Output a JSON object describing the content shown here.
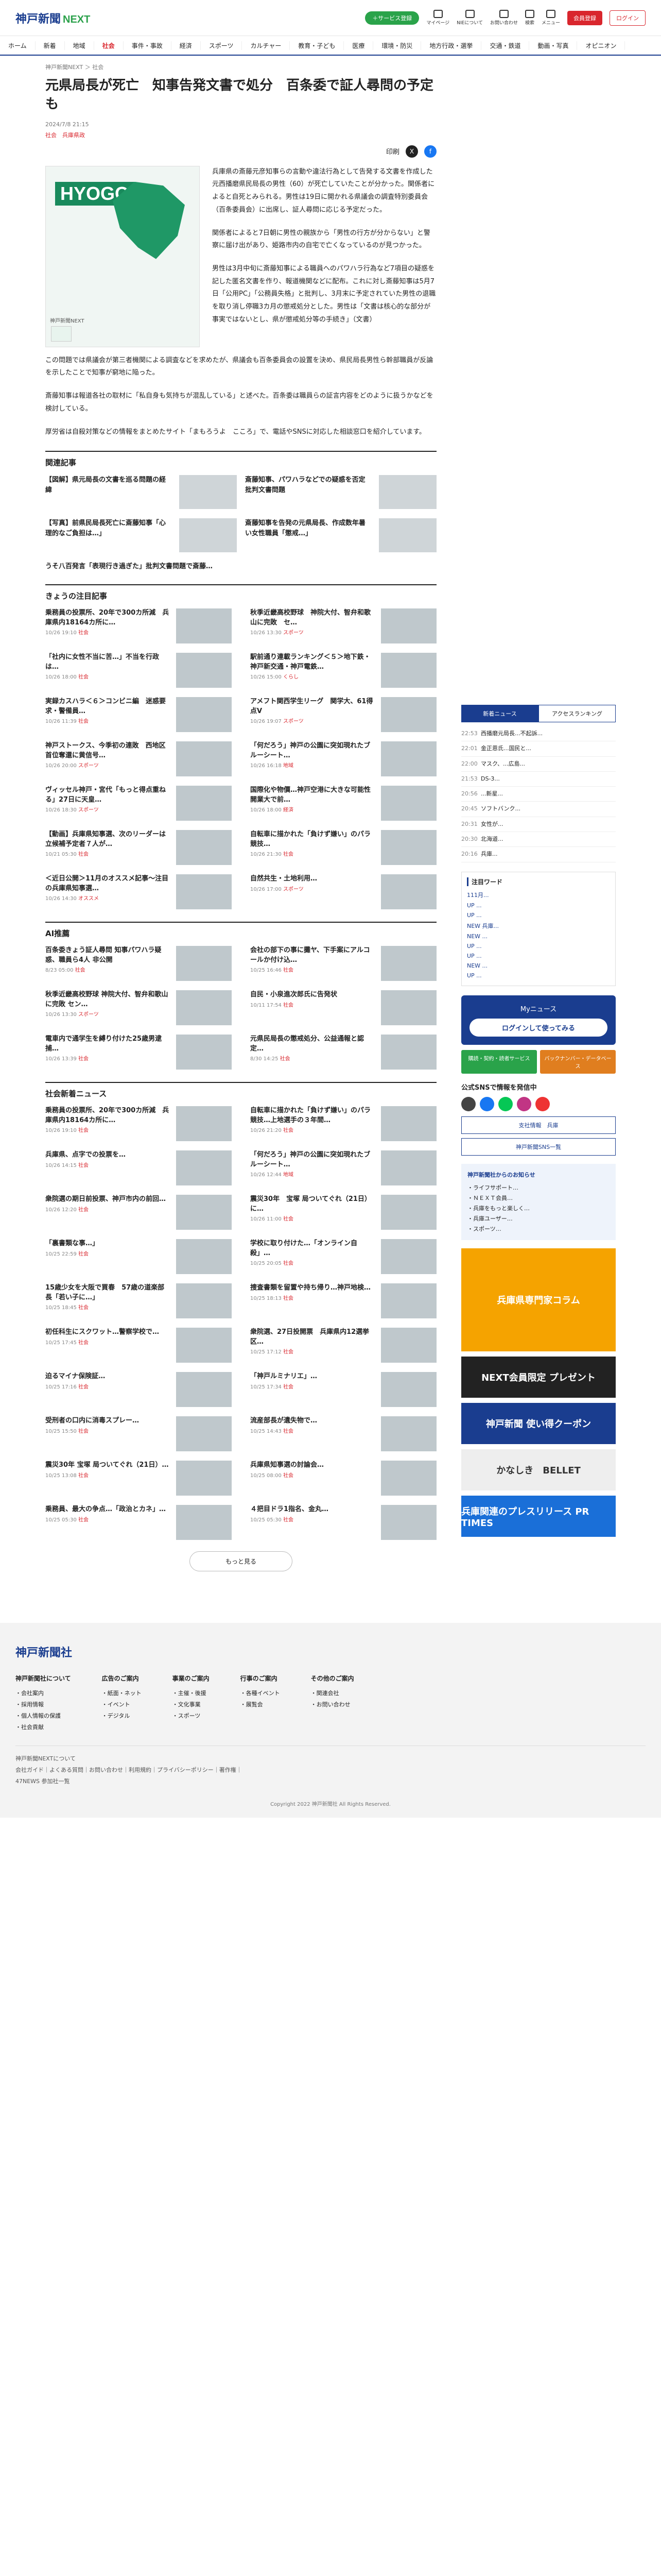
{
  "header": {
    "logo": "神戸新聞",
    "logo_next": "NEXT",
    "signup": "＋サービス登録",
    "icons": [
      "マイページ",
      "NIEについて",
      "お問い合わせ",
      "検索",
      "メニュー"
    ],
    "member": "会員登録",
    "login": "ログイン"
  },
  "nav": [
    "ホーム",
    "新着",
    "地域",
    "社会",
    "事件・事故",
    "経済",
    "スポーツ",
    "カルチャー",
    "教育・子ども",
    "医療",
    "環境・防災",
    "地方行政・選挙",
    "交通・鉄道",
    "動画・写真",
    "オピニオン"
  ],
  "crumb": "神戸新聞NEXT ＞ 社会",
  "article": {
    "title": "元県局長が死亡　知事告発文書で処分　百条委で証人尋問の予定も",
    "date": "2024/7/8 21:15",
    "tags": "社会　兵庫県政",
    "print": "印刷",
    "map_label": "HYOGO",
    "map_caption": "神戸新聞NEXT",
    "p1": "兵庫県の斎藤元彦知事らの言動や違法行為として告発する文書を作成した元西播磨県民局長の男性（60）が死亡していたことが分かった。関係者によると自死とみられる。男性は19日に開かれる県議会の調査特別委員会（百条委員会）に出席し、証人尋問に応じる予定だった。",
    "p2": "関係者によると7日朝に男性の親族から「男性の行方が分からない」と警察に届け出があり、姫路市内の自宅で亡くなっているのが見つかった。",
    "p3": "男性は3月中旬に斎藤知事による職員へのパワハラ行為など7項目の疑惑を記した匿名文書を作り、報道機関などに配布。これに対し斎藤知事は5月7日「公用PC」「公務員失格」と批判し、3月末に予定されていた男性の退職を取り消し停職3カ月の懲戒処分とした。男性は「文書は核心的な部分が事実ではないとし、県が懲戒処分等の手続き」（文書）",
    "p4": "この問題では県議会が第三者機関による調査などを求めたが、県議会も百条委員会の設置を決め、県民局長男性ら幹部職員が反論を示したことで知事が窮地に陥った。",
    "p5": "斎藤知事は報道各社の取材に「私自身も気持ちが混乱している」と述べた。百条委は職員らの証言内容をどのように扱うかなどを検討している。",
    "p6": "厚労省は自殺対策などの情報をまとめたサイト「まもろうよ　こころ」で、電話やSNSに対応した相談窓口を紹介しています。"
  },
  "related": {
    "title": "関連記事",
    "items": [
      "【図解】県元局長の文書を巡る問題の経緯",
      "斎藤知事、パワハラなどでの疑惑を否定　批判文書問題",
      "【写真】前県民局長死亡に斎藤知事「心理的なご負担は…」",
      "斎藤知事を告発の元県局長、作成数年暑い女性職員「懲戒…」",
      "うそ八百発言「表現行き過ぎた」批判文書問題で斎藤…"
    ]
  },
  "popular": {
    "title": "きょうの注目記事",
    "items": [
      [
        "乗務員の投票所、20年で300カ所減　兵庫県内18164カ所に…",
        "10/26 19:10",
        "社会"
      ],
      [
        "秋季近畿高校野球　神院大付、智弁和歌山に完敗　セ…",
        "10/26 13:30",
        "スポーツ"
      ],
      [
        "「社内に女性不当に苦…」不当を行政は…",
        "10/26 18:00",
        "社会"
      ],
      [
        "駅前通り連載ランキング＜５＞地下鉄・神戸新交通・神戸電鉄…",
        "10/26 15:00",
        "くらし"
      ],
      [
        "実録カスハラ＜６＞コンビニ編　迷惑要求・警備員…",
        "10/26 11:39",
        "社会"
      ],
      [
        "アメフト関西学生リーグ　関学大、61得点V",
        "10/26 19:07",
        "スポーツ"
      ],
      [
        "神戸ストークス、今季初の連敗　西地区首位奪還に黄信号…",
        "10/26 20:00",
        "スポーツ"
      ],
      [
        "「何だろう」神戸の公園に突如現れたブルーシート…",
        "10/26 16:18",
        "地域"
      ],
      [
        "ヴィッセル神戸・宮代「もっと得点重ねる」27日に天皇…",
        "10/26 18:30",
        "スポーツ"
      ],
      [
        "国際化や物價…神戸空港に大きな可能性　開業大で前…",
        "10/26 18:00",
        "経済"
      ],
      [
        "【動画】兵庫県知事選、次のリーダーは　立候補予定者７人が…",
        "10/21 05:30",
        "社会"
      ],
      [
        "自転車に描かれた「負けず嫌い」のパラ競技…",
        "10/26 21:30",
        "社会"
      ],
      [
        "＜近日公開＞11月のオススメ記事〜注目の兵庫県知事選…",
        "10/26 14:30",
        "オススメ"
      ],
      [
        "自然共生・土地利用…",
        "10/26 17:00",
        "スポーツ"
      ]
    ]
  },
  "ai": {
    "title": "AI推薦",
    "items": [
      [
        "百条委きょう証人尋問 知事パワハラ疑惑、職員ら4人 非公開",
        "8/23 05:00",
        "社会"
      ],
      [
        "会社の部下の事に攤ヤ、下手案にアルコールか付け込…",
        "10/25 16:46",
        "社会"
      ],
      [
        "秋季近畿高校野球 神院大付、智弁和歌山に完敗 セン…",
        "10/26 13:30",
        "スポーツ"
      ],
      [
        "自民・小泉進次郎氏に告発状",
        "10/11 17:54",
        "社会"
      ],
      [
        "電車内で通学生を縛り付けた25歳男逮捕…",
        "10/26 13:39",
        "社会"
      ],
      [
        "元県民局長の懲戒処分、公益通報と認定…",
        "8/30 14:25",
        "社会"
      ]
    ]
  },
  "social": {
    "title": "社会新着ニュース",
    "items": [
      [
        "乗務員の投票所、20年で300カ所減　兵庫県内18164カ所に…",
        "10/26 19:10",
        "社会"
      ],
      [
        "自転車に描かれた「負けず嫌い」のパラ競技…上地選手の３年間…",
        "10/26 21:20",
        "社会"
      ],
      [
        "兵庫県、点字での投票を…",
        "10/26 14:15",
        "社会"
      ],
      [
        "「何だろう」神戸の公園に突如現れたブルーシート…",
        "10/26 12:44",
        "地域"
      ],
      [
        "衆院選の期日前投票、神戸市内の前回…",
        "10/26 12:20",
        "社会"
      ],
      [
        "震災30年　宝塚 局ついてぐれ（21日）に…",
        "10/26 11:00",
        "社会"
      ],
      [
        "「裏書類な事…」",
        "10/25 22:59",
        "社会"
      ],
      [
        "学校に取り付けた…「オンライン自殺」…",
        "10/25 20:05",
        "社会"
      ],
      [
        "15歳少女を大阪で買春　57歳の道楽部長「若い子に…」",
        "10/25 18:45",
        "社会"
      ],
      [
        "捜査書類を留置や持ち帰り…神戸地検…",
        "10/25 18:13",
        "社会"
      ],
      [
        "初任科生にスクワット…警察学校で…",
        "10/25 17:45",
        "社会"
      ],
      [
        "衆院選、27日投開票　兵庫県内12選挙区…",
        "10/25 17:12",
        "社会"
      ],
      [
        "迫るマイナ保険証…",
        "10/25 17:16",
        "社会"
      ],
      [
        "「神戸ルミナリエ」…",
        "10/25 17:34",
        "社会"
      ],
      [
        "受刑者の口内に消毒スプレー…",
        "10/25 15:50",
        "社会"
      ],
      [
        "流産部長が遺失物で…",
        "10/25 14:43",
        "社会"
      ],
      [
        "震災30年 宝塚 局ついてぐれ（21日）…",
        "10/25 13:08",
        "社会"
      ],
      [
        "兵庫県知事選の討論会…",
        "10/25 08:00",
        "社会"
      ],
      [
        "乗務員、最大の争点…「政治とカネ」…",
        "10/25 05:30",
        "社会"
      ],
      [
        "４把目ドラ1指名、金丸…",
        "10/25 05:30",
        "社会"
      ]
    ]
  },
  "more": "もっと見る",
  "ranking": {
    "tabs": [
      "新着ニュース",
      "アクセスランキング"
    ],
    "items": [
      [
        "22:53",
        "西播磨元局長...不起訴..."
      ],
      [
        "22:01",
        "金正恩氏...国民と..."
      ],
      [
        "22:00",
        "マスク、...広島..."
      ],
      [
        "21:53",
        "DS-3..."
      ],
      [
        "20:56",
        "...新星..."
      ],
      [
        "20:45",
        "ソフトバンク..."
      ],
      [
        "20:31",
        "女性が..."
      ],
      [
        "20:30",
        "北海道..."
      ],
      [
        "20:16",
        "兵庫..."
      ]
    ]
  },
  "notice_box": {
    "title": "注目ワード",
    "items": [
      "111月...",
      "UP ...",
      "UP ...",
      "NEW 兵庫...",
      "NEW ...",
      "UP ...",
      "UP ...",
      "NEW ...",
      "UP ..."
    ]
  },
  "my": {
    "title": "Myニュース",
    "login": "ログインして使ってみる"
  },
  "pills": [
    "購読・契約・読者サービス",
    "バックナンバー・データベース"
  ],
  "follow": "公式SNSで情報を発信中",
  "sns_buttons": [
    "支社情報　兵庫",
    "神戸新聞SNS一覧"
  ],
  "news_box": {
    "title": "神戸新聞社からのお知らせ",
    "lines": [
      "・ライフサポート…",
      "・ＮＥＸＴ会員…",
      "・兵庫をもっと楽しく…",
      "・兵庫ユーザー…",
      "・スポーツ…"
    ]
  },
  "banners": [
    "兵庫県専門家コラム",
    "NEXT会員限定 プレゼント",
    "神戸新聞 使い得クーポン",
    "かなしき　BELLET",
    "兵庫関連のプレスリリース PR TIMES"
  ],
  "footer": {
    "logo": "神戸新聞社",
    "cols": [
      {
        "h": "神戸新聞社について",
        "items": [
          "会社案内",
          "採用情報",
          "個人情報の保護",
          "社会貢献"
        ]
      },
      {
        "h": "広告のご案内",
        "items": [
          "紙面・ネット",
          "イベント",
          "デジタル"
        ]
      },
      {
        "h": "事業のご案内",
        "items": [
          "主催・後援",
          "文化事業",
          "スポーツ"
        ]
      },
      {
        "h": "行事のご案内",
        "items": [
          "各種イベント",
          "展覧会"
        ]
      },
      {
        "h": "その他のご案内",
        "items": [
          "関連会社",
          "お問い合わせ"
        ]
      }
    ],
    "next": "神戸新聞NEXTについて",
    "links": "会社ガイド｜よくある質問｜お問い合わせ｜利用規約｜プライバシーポリシー｜著作権｜",
    "fourseven": "47NEWS 参加社一覧",
    "copyright": "Copyright 2022 神戸新聞社 All Rights Reserved."
  }
}
